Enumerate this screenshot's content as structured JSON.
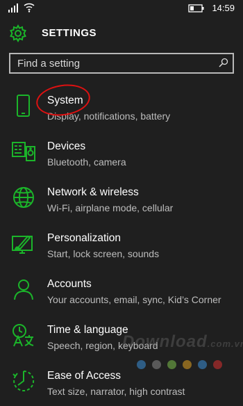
{
  "status_bar": {
    "time": "14:59"
  },
  "header": {
    "title": "SETTINGS"
  },
  "search": {
    "placeholder": "Find a setting"
  },
  "items": [
    {
      "label": "System",
      "sub": "Display, notifications, battery",
      "icon": "phone-icon"
    },
    {
      "label": "Devices",
      "sub": "Bluetooth, camera",
      "icon": "devices-icon"
    },
    {
      "label": "Network & wireless",
      "sub": "Wi-Fi, airplane mode, cellular",
      "icon": "globe-icon"
    },
    {
      "label": "Personalization",
      "sub": "Start, lock screen, sounds",
      "icon": "paint-icon"
    },
    {
      "label": "Accounts",
      "sub": "Your accounts, email, sync, Kid’s Corner",
      "icon": "person-icon"
    },
    {
      "label": "Time & language",
      "sub": "Speech, region, keyboard",
      "icon": "time-language-icon"
    },
    {
      "label": "Ease of Access",
      "sub": "Text size, narrator, high contrast",
      "icon": "ease-of-access-icon"
    }
  ],
  "watermark": {
    "text": "Download",
    "suffix": ".com.vn"
  },
  "colors": {
    "accent": "#1bb52a",
    "background": "#1f1f1f",
    "annotation": "#dd1111"
  }
}
